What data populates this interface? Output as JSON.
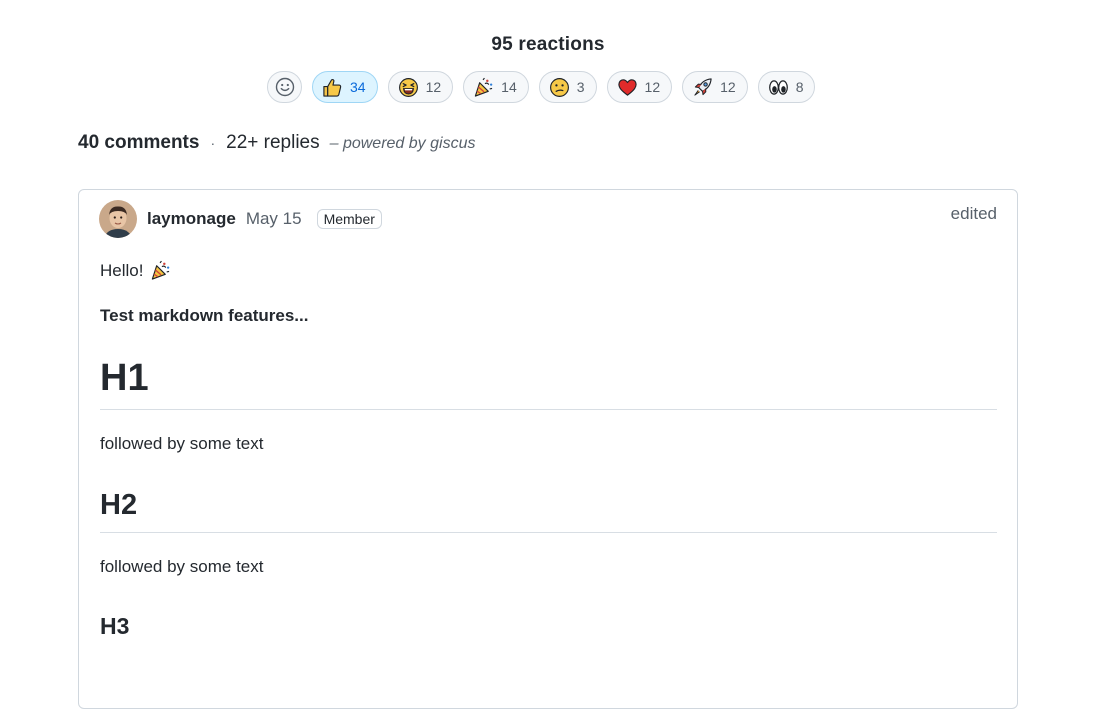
{
  "reactions": {
    "title": "95 reactions",
    "items": [
      {
        "name": "thumbs-up",
        "count": "34",
        "active": true
      },
      {
        "name": "laugh",
        "count": "12"
      },
      {
        "name": "hooray",
        "count": "14"
      },
      {
        "name": "confused",
        "count": "3"
      },
      {
        "name": "heart",
        "count": "12"
      },
      {
        "name": "rocket",
        "count": "12"
      },
      {
        "name": "eyes",
        "count": "8"
      }
    ]
  },
  "thread": {
    "comments": "40 comments",
    "replies": "22+ replies",
    "powered_by": "– powered by giscus"
  },
  "comment": {
    "author": "laymonage",
    "date": "May 15",
    "badge": "Member",
    "edited": "edited",
    "body": {
      "hello": "Hello!",
      "bold_line": "Test markdown features...",
      "h1": "H1",
      "text1": "followed by some text",
      "h2": "H2",
      "text2": "followed by some text",
      "h3": "H3"
    }
  },
  "colors": {
    "accent": "#0969da",
    "border": "#d0d7de",
    "active_bg": "#ddf4ff"
  }
}
